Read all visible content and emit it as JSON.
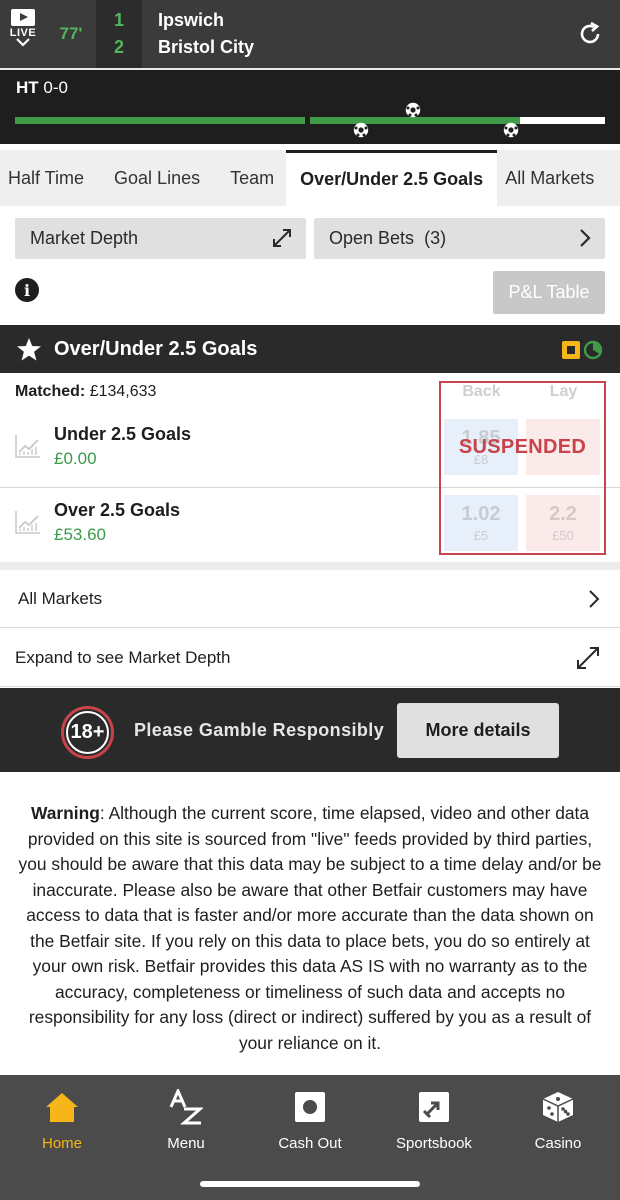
{
  "score": {
    "live_label": "LIVE",
    "clock": "77'",
    "home_score": "1",
    "away_score": "2",
    "home_team": "Ipswich",
    "away_team": "Bristol City"
  },
  "timeline": {
    "ht_label": "HT",
    "ht_score": "0-0",
    "colors": {
      "played": "#3f9b47",
      "remaining": "#ffffff"
    }
  },
  "tabs": [
    {
      "label": "Half Time",
      "active": false
    },
    {
      "label": "Goal Lines",
      "active": false
    },
    {
      "label": "Team",
      "active": false
    },
    {
      "label": "Over/Under 2.5 Goals",
      "active": true
    },
    {
      "label": "All Markets",
      "active": false
    }
  ],
  "controls": {
    "market_depth_label": "Market Depth",
    "open_bets_label": "Open Bets",
    "open_bets_count": "(3)",
    "pl_table_label": "P&L Table"
  },
  "market": {
    "title": "Over/Under 2.5 Goals",
    "matched_label": "Matched:",
    "matched_value": "£134,633",
    "back_label": "Back",
    "lay_label": "Lay",
    "status": "SUSPENDED",
    "runners": [
      {
        "name": "Under 2.5 Goals",
        "pl": "£0.00",
        "back_price": "1.85",
        "back_size": "£8",
        "lay_price": "",
        "lay_size": ""
      },
      {
        "name": "Over 2.5 Goals",
        "pl": "£53.60",
        "back_price": "1.02",
        "back_size": "£5",
        "lay_price": "2.2",
        "lay_size": "£50"
      }
    ]
  },
  "links": {
    "all_markets": "All Markets",
    "expand_depth": "Expand to see Market Depth"
  },
  "responsible": {
    "badge": "18+",
    "text": "Please Gamble Responsibly",
    "button": "More details"
  },
  "warning": {
    "heading": "Warning",
    "body": ": Although the current score, time elapsed, video and other data provided on this site is sourced from \"live\" feeds provided by third parties, you should be aware that this data may be subject to a time delay and/or be inaccurate.  Please also be aware that other Betfair customers may have access to data that is faster and/or more accurate than the data shown on the Betfair site. If you rely on this data to place bets, you do so entirely at your own risk. Betfair provides this data AS IS with no warranty as to the accuracy, completeness or timeliness of such data and accepts no responsibility for any loss (direct or indirect) suffered by you as a result of your reliance on it."
  },
  "nav": [
    {
      "label": "Home",
      "icon": "home-icon",
      "active": true
    },
    {
      "label": "Menu",
      "icon": "az-menu-icon",
      "active": false
    },
    {
      "label": "Cash Out",
      "icon": "cash-out-icon",
      "active": false
    },
    {
      "label": "Sportsbook",
      "icon": "sportsbook-icon",
      "active": false
    },
    {
      "label": "Casino",
      "icon": "dice-icon",
      "active": false
    }
  ],
  "colors": {
    "accent": "#f6b519",
    "green": "#3a9b48",
    "suspended": "#c8434a"
  }
}
